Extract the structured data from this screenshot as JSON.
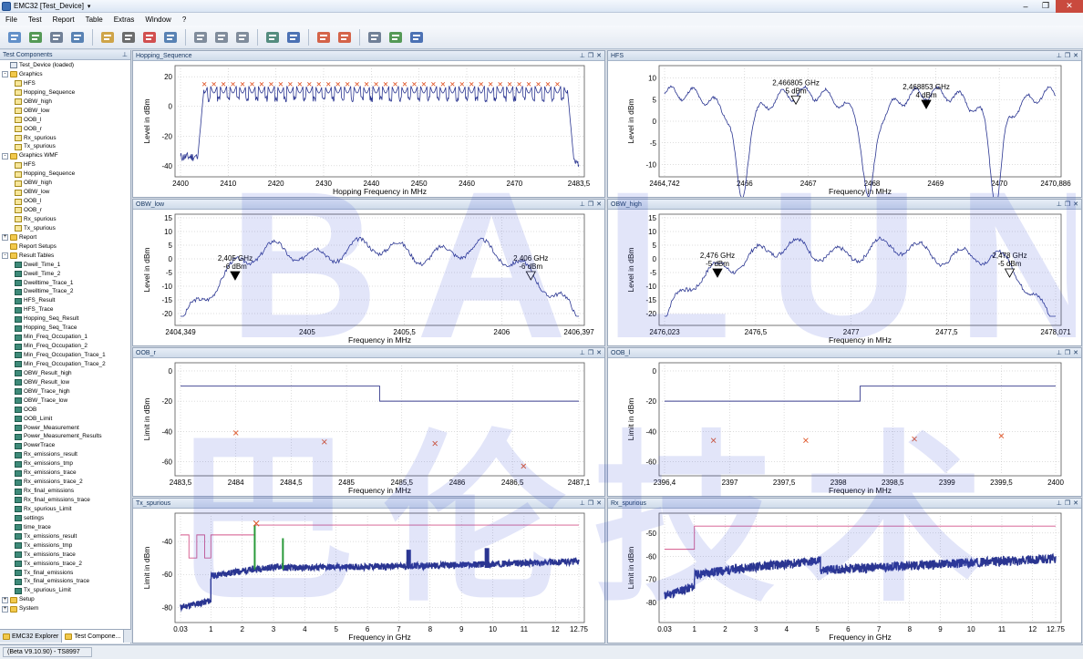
{
  "app": {
    "title": "EMC32 [Test_Device]",
    "status": "(Beta V9.10.90) - TS8997"
  },
  "menu": [
    "File",
    "Test",
    "Report",
    "Table",
    "Extras",
    "Window",
    "?"
  ],
  "toolbar_icons": [
    "table-icon",
    "trend-graph-icon",
    "report-icon",
    "tree-icon",
    "edit-icon",
    "print-icon",
    "pdf-icon",
    "export-icon",
    "database-add-icon",
    "database-save-icon",
    "database-delete-icon",
    "camera-icon",
    "info-icon",
    "test1-run-icon",
    "test2-run-icon",
    "tools-icon",
    "plug-icon",
    "antenna-icon"
  ],
  "left_panel": {
    "title": "Test Components",
    "tree": [
      {
        "level": 0,
        "icon": "root",
        "label": "Test_Device (loaded)"
      },
      {
        "level": 0,
        "icon": "folder",
        "label": "Graphics",
        "exp": "-"
      },
      {
        "level": 1,
        "icon": "graph",
        "label": "HFS"
      },
      {
        "level": 1,
        "icon": "graph",
        "label": "Hopping_Sequence"
      },
      {
        "level": 1,
        "icon": "graph",
        "label": "OBW_high"
      },
      {
        "level": 1,
        "icon": "graph",
        "label": "OBW_low"
      },
      {
        "level": 1,
        "icon": "graph",
        "label": "OOB_l"
      },
      {
        "level": 1,
        "icon": "graph",
        "label": "OOB_r"
      },
      {
        "level": 1,
        "icon": "graph",
        "label": "Rx_spurious"
      },
      {
        "level": 1,
        "icon": "graph",
        "label": "Tx_spurious"
      },
      {
        "level": 0,
        "icon": "folder",
        "label": "Graphics WMF",
        "exp": "-"
      },
      {
        "level": 1,
        "icon": "graph",
        "label": "HFS"
      },
      {
        "level": 1,
        "icon": "graph",
        "label": "Hopping_Sequence"
      },
      {
        "level": 1,
        "icon": "graph",
        "label": "OBW_high"
      },
      {
        "level": 1,
        "icon": "graph",
        "label": "OBW_low"
      },
      {
        "level": 1,
        "icon": "graph",
        "label": "OOB_l"
      },
      {
        "level": 1,
        "icon": "graph",
        "label": "OOB_r"
      },
      {
        "level": 1,
        "icon": "graph",
        "label": "Rx_spurious"
      },
      {
        "level": 1,
        "icon": "graph",
        "label": "Tx_spurious"
      },
      {
        "level": 0,
        "icon": "folder",
        "label": "Report",
        "exp": "+"
      },
      {
        "level": 0,
        "icon": "folder",
        "label": "Report Setups"
      },
      {
        "level": 0,
        "icon": "folder",
        "label": "Result Tables",
        "exp": "-"
      },
      {
        "level": 1,
        "icon": "table",
        "label": "Dwell_Time_1"
      },
      {
        "level": 1,
        "icon": "table",
        "label": "Dwell_Time_2"
      },
      {
        "level": 1,
        "icon": "table",
        "label": "Dwelltime_Trace_1"
      },
      {
        "level": 1,
        "icon": "table",
        "label": "Dwelltime_Trace_2"
      },
      {
        "level": 1,
        "icon": "table",
        "label": "HFS_Result"
      },
      {
        "level": 1,
        "icon": "table",
        "label": "HFS_Trace"
      },
      {
        "level": 1,
        "icon": "table",
        "label": "Hopping_Seq_Result"
      },
      {
        "level": 1,
        "icon": "table",
        "label": "Hopping_Seq_Trace"
      },
      {
        "level": 1,
        "icon": "table",
        "label": "Min_Freq_Occupation_1"
      },
      {
        "level": 1,
        "icon": "table",
        "label": "Min_Freq_Occupation_2"
      },
      {
        "level": 1,
        "icon": "table",
        "label": "Min_Freq_Occupation_Trace_1"
      },
      {
        "level": 1,
        "icon": "table",
        "label": "Min_Freq_Occupation_Trace_2"
      },
      {
        "level": 1,
        "icon": "table",
        "label": "OBW_Result_high"
      },
      {
        "level": 1,
        "icon": "table",
        "label": "OBW_Result_low"
      },
      {
        "level": 1,
        "icon": "table",
        "label": "OBW_Trace_high"
      },
      {
        "level": 1,
        "icon": "table",
        "label": "OBW_Trace_low"
      },
      {
        "level": 1,
        "icon": "table",
        "label": "OOB"
      },
      {
        "level": 1,
        "icon": "table",
        "label": "OOB_Limit"
      },
      {
        "level": 1,
        "icon": "table",
        "label": "Power_Measurement"
      },
      {
        "level": 1,
        "icon": "table",
        "label": "Power_Measurement_Results"
      },
      {
        "level": 1,
        "icon": "table",
        "label": "PowerTrace"
      },
      {
        "level": 1,
        "icon": "table",
        "label": "Rx_emissions_result"
      },
      {
        "level": 1,
        "icon": "table",
        "label": "Rx_emissions_tmp"
      },
      {
        "level": 1,
        "icon": "table",
        "label": "Rx_emissions_trace"
      },
      {
        "level": 1,
        "icon": "table",
        "label": "Rx_emissions_trace_2"
      },
      {
        "level": 1,
        "icon": "table",
        "label": "Rx_final_emissions"
      },
      {
        "level": 1,
        "icon": "table",
        "label": "Rx_final_emissions_trace"
      },
      {
        "level": 1,
        "icon": "table",
        "label": "Rx_spurious_Limit"
      },
      {
        "level": 1,
        "icon": "table",
        "label": "settings"
      },
      {
        "level": 1,
        "icon": "table",
        "label": "time_trace"
      },
      {
        "level": 1,
        "icon": "table",
        "label": "Tx_emissions_result"
      },
      {
        "level": 1,
        "icon": "table",
        "label": "Tx_emissions_tmp"
      },
      {
        "level": 1,
        "icon": "table",
        "label": "Tx_emissions_trace"
      },
      {
        "level": 1,
        "icon": "table",
        "label": "Tx_emissions_trace_2"
      },
      {
        "level": 1,
        "icon": "table",
        "label": "Tx_final_emissions"
      },
      {
        "level": 1,
        "icon": "table",
        "label": "Tx_final_emissions_trace"
      },
      {
        "level": 1,
        "icon": "table",
        "label": "Tx_spurious_Limit"
      },
      {
        "level": 0,
        "icon": "folder",
        "label": "Setup",
        "exp": "+"
      },
      {
        "level": 0,
        "icon": "folder",
        "label": "System",
        "exp": "+"
      }
    ],
    "tabs": [
      "EMC32 Explorer",
      "Test Compone..."
    ]
  },
  "watermark": {
    "line1": "BALUN",
    "line2": "巴伦技术"
  },
  "chart_data": [
    {
      "id": "hopping",
      "panel_title": "Hopping_Sequence",
      "type": "line",
      "xlabel": "Hopping Frequency in MHz",
      "ylabel": "Level in dBm",
      "xlim": [
        2400,
        2483.5
      ],
      "ylim": [
        -45,
        25
      ],
      "xticks": [
        "2400",
        "2410",
        "2420",
        "2430",
        "2440",
        "2450",
        "2460",
        "2470",
        "2483,5"
      ],
      "xtickv": [
        2400,
        2410,
        2420,
        2430,
        2440,
        2450,
        2460,
        2470,
        2483.5
      ],
      "yticks": [
        "20",
        "0",
        "-20",
        "-40"
      ],
      "ytickv": [
        20,
        0,
        -20,
        -40
      ],
      "trace_gen": {
        "kind": "hop",
        "start": 2405,
        "end": 2481,
        "n": 38,
        "top": 15,
        "dip": 5,
        "floor": -38
      },
      "markers_x": {
        "start": 2405,
        "step": 2,
        "count": 38,
        "y": 15
      }
    },
    {
      "id": "hfs",
      "panel_title": "HFS",
      "type": "line",
      "xlabel": "Frequency in MHz",
      "ylabel": "Level in dBm",
      "xlim": [
        2464.742,
        2470.886
      ],
      "ylim": [
        -12,
        12
      ],
      "xticks": [
        "2464,742",
        "2466",
        "2467",
        "2468",
        "2469",
        "2470",
        "2470,886"
      ],
      "xtickv": [
        2464.742,
        2466,
        2467,
        2468,
        2469,
        2470,
        2470.886
      ],
      "yticks": [
        "10",
        "5",
        "0",
        "-5",
        "-10"
      ],
      "ytickv": [
        10,
        5,
        0,
        -5,
        -10
      ],
      "trace_gen": {
        "kind": "hfs",
        "dips": [
          2465.95,
          2467.95,
          2469.95
        ],
        "peaks": [
          2464.9,
          2466.95,
          2468.95,
          2470.8
        ],
        "top": 8,
        "bottom": -11
      },
      "annotations": [
        {
          "x": 2466.805,
          "y": 5,
          "text1": "2,466805 GHz",
          "text2": "5 dBm",
          "filled": false
        },
        {
          "x": 2468.853,
          "y": 4,
          "text1": "2,468853 GHz",
          "text2": "4 dBm",
          "filled": true
        }
      ]
    },
    {
      "id": "obwlow",
      "panel_title": "OBW_low",
      "type": "line",
      "xlabel": "Frequency in MHz",
      "ylabel": "Level in dBm",
      "xlim": [
        2404.349,
        2406.397
      ],
      "ylim": [
        -23,
        15
      ],
      "xticks": [
        "2404,349",
        "2405",
        "2405,5",
        "2406",
        "2406,397"
      ],
      "xtickv": [
        2404.349,
        2405,
        2405.5,
        2406,
        2406.397
      ],
      "yticks": [
        "15",
        "10",
        "5",
        "0",
        "-5",
        "-10",
        "-15",
        "-20"
      ],
      "ytickv": [
        15,
        10,
        5,
        0,
        -5,
        -10,
        -15,
        -20
      ],
      "trace_gen": {
        "kind": "obw",
        "top": 6,
        "edge": -21,
        "seed": 3
      },
      "annotations": [
        {
          "x": 2404.63,
          "y": -6,
          "text1": "2,405 GHz",
          "text2": "-6 dBm",
          "filled": true
        },
        {
          "x": 2406.15,
          "y": -6,
          "text1": "2,406 GHz",
          "text2": "-6 dBm",
          "filled": false
        }
      ]
    },
    {
      "id": "obwhigh",
      "panel_title": "OBW_high",
      "type": "line",
      "xlabel": "Frequency in MHz",
      "ylabel": "Level in dBm",
      "xlim": [
        2476.023,
        2478.071
      ],
      "ylim": [
        -23,
        15
      ],
      "xticks": [
        "2476,023",
        "2476,5",
        "2477",
        "2477,5",
        "2478,071"
      ],
      "xtickv": [
        2476.023,
        2476.5,
        2477,
        2477.5,
        2478.071
      ],
      "yticks": [
        "15",
        "10",
        "5",
        "0",
        "-5",
        "-10",
        "-15",
        "-20"
      ],
      "ytickv": [
        15,
        10,
        5,
        0,
        -5,
        -10,
        -15,
        -20
      ],
      "trace_gen": {
        "kind": "obw",
        "top": 6,
        "edge": -21,
        "seed": 7
      },
      "annotations": [
        {
          "x": 2476.3,
          "y": -5,
          "text1": "2,476 GHz",
          "text2": "-5 dBm",
          "filled": true
        },
        {
          "x": 2477.83,
          "y": -5,
          "text1": "2,478 GHz",
          "text2": "-5 dBm",
          "filled": false
        }
      ]
    },
    {
      "id": "oobr",
      "panel_title": "OOB_r",
      "type": "scatter",
      "xlabel": "Frequency in MHz",
      "ylabel": "Limit in dBm",
      "xlim": [
        2483.5,
        2487.1
      ],
      "ylim": [
        -67,
        3
      ],
      "xticks": [
        "2483,5",
        "2484",
        "2484,5",
        "2485",
        "2485,5",
        "2486",
        "2486,5",
        "2487,1"
      ],
      "xtickv": [
        2483.5,
        2484,
        2484.5,
        2485,
        2485.5,
        2486,
        2486.5,
        2487.1
      ],
      "yticks": [
        "0",
        "-20",
        "-40",
        "-60"
      ],
      "ytickv": [
        0,
        -20,
        -40,
        -60
      ],
      "limit": [
        [
          2483.5,
          -10
        ],
        [
          2485.3,
          -10
        ],
        [
          2485.3,
          -20
        ],
        [
          2487.1,
          -20
        ]
      ],
      "points": [
        [
          2484,
          -41
        ],
        [
          2484.8,
          -47
        ],
        [
          2485.8,
          -48
        ],
        [
          2486.6,
          -63
        ]
      ]
    },
    {
      "id": "oobl",
      "panel_title": "OOB_l",
      "type": "scatter",
      "xlabel": "Frequency in MHz",
      "ylabel": "Limit in dBm",
      "xlim": [
        2396.4,
        2400
      ],
      "ylim": [
        -67,
        3
      ],
      "xticks": [
        "2396,4",
        "2397",
        "2397,5",
        "2398",
        "2398,5",
        "2399",
        "2399,5",
        "2400"
      ],
      "xtickv": [
        2396.4,
        2397,
        2397.5,
        2398,
        2398.5,
        2399,
        2399.5,
        2400
      ],
      "yticks": [
        "0",
        "-20",
        "-40",
        "-60"
      ],
      "ytickv": [
        0,
        -20,
        -40,
        -60
      ],
      "limit": [
        [
          2396.4,
          -20
        ],
        [
          2398.2,
          -20
        ],
        [
          2398.2,
          -10
        ],
        [
          2400,
          -10
        ]
      ],
      "points": [
        [
          2396.85,
          -46
        ],
        [
          2397.7,
          -46
        ],
        [
          2398.7,
          -45
        ],
        [
          2399.5,
          -43
        ]
      ]
    },
    {
      "id": "txspur",
      "panel_title": "Tx_spurious",
      "type": "line",
      "xlabel": "Frequency in GHz",
      "ylabel": "Limit in dBm",
      "xlim": [
        0.03,
        12.75
      ],
      "ylim": [
        -87,
        -25
      ],
      "xticks": [
        "0.03",
        "1",
        "2",
        "3",
        "4",
        "5",
        "6",
        "7",
        "8",
        "9",
        "10",
        "11",
        "12",
        "12.75"
      ],
      "xtickv": [
        0.03,
        1,
        2,
        3,
        4,
        5,
        6,
        7,
        8,
        9,
        10,
        11,
        12,
        12.75
      ],
      "yticks": [
        "-40",
        "-60",
        "-80"
      ],
      "ytickv": [
        -40,
        -60,
        -80
      ],
      "limit": [
        [
          0.03,
          -36
        ],
        [
          0.3,
          -36
        ],
        [
          0.3,
          -50
        ],
        [
          0.55,
          -50
        ],
        [
          0.55,
          -36
        ],
        [
          0.8,
          -36
        ],
        [
          0.8,
          -50
        ],
        [
          1,
          -50
        ],
        [
          1,
          -36
        ],
        [
          2.4,
          -36
        ],
        [
          2.4,
          -30
        ],
        [
          12.75,
          -30
        ]
      ],
      "trace_gen": {
        "kind": "spur",
        "segments": [
          [
            0.03,
            1,
            -80,
            -76
          ],
          [
            1,
            2.3,
            -61,
            -57
          ],
          [
            2.3,
            3.3,
            -57,
            -55
          ],
          [
            3.3,
            7.2,
            -56,
            -55
          ],
          [
            7.2,
            9.5,
            -55,
            -54
          ],
          [
            9.5,
            12.75,
            -54,
            -52
          ]
        ],
        "bursts": [
          [
            7.3,
            -45
          ],
          [
            9.8,
            -44
          ]
        ],
        "green": [
          [
            2.4,
            -30
          ],
          [
            3.3,
            -38
          ]
        ],
        "marker_x": 2.45,
        "marker_y": -29
      }
    },
    {
      "id": "rxspur",
      "panel_title": "Rx_spurious",
      "type": "line",
      "xlabel": "Frequency in GHz",
      "ylabel": "Limit in dBm",
      "xlim": [
        0.03,
        12.75
      ],
      "ylim": [
        -87,
        -43
      ],
      "xticks": [
        "0.03",
        "1",
        "2",
        "3",
        "4",
        "5",
        "6",
        "7",
        "8",
        "9",
        "10",
        "11",
        "12",
        "12.75"
      ],
      "xtickv": [
        0.03,
        1,
        2,
        3,
        4,
        5,
        6,
        7,
        8,
        9,
        10,
        11,
        12,
        12.75
      ],
      "yticks": [
        "-50",
        "-60",
        "-70",
        "-80"
      ],
      "ytickv": [
        -50,
        -60,
        -70,
        -80
      ],
      "limit": [
        [
          0.03,
          -57
        ],
        [
          1,
          -57
        ],
        [
          1,
          -47
        ],
        [
          12.75,
          -47
        ]
      ],
      "trace_gen": {
        "kind": "spur",
        "segments": [
          [
            0.03,
            1,
            -77,
            -73
          ],
          [
            1,
            2.6,
            -68,
            -65
          ],
          [
            2.6,
            5.1,
            -65,
            -62
          ],
          [
            5.1,
            8.1,
            -66,
            -64
          ],
          [
            8.1,
            12.75,
            -64,
            -61
          ]
        ],
        "bursts": [],
        "green": [],
        "marker_x": null,
        "marker_y": null
      }
    }
  ]
}
